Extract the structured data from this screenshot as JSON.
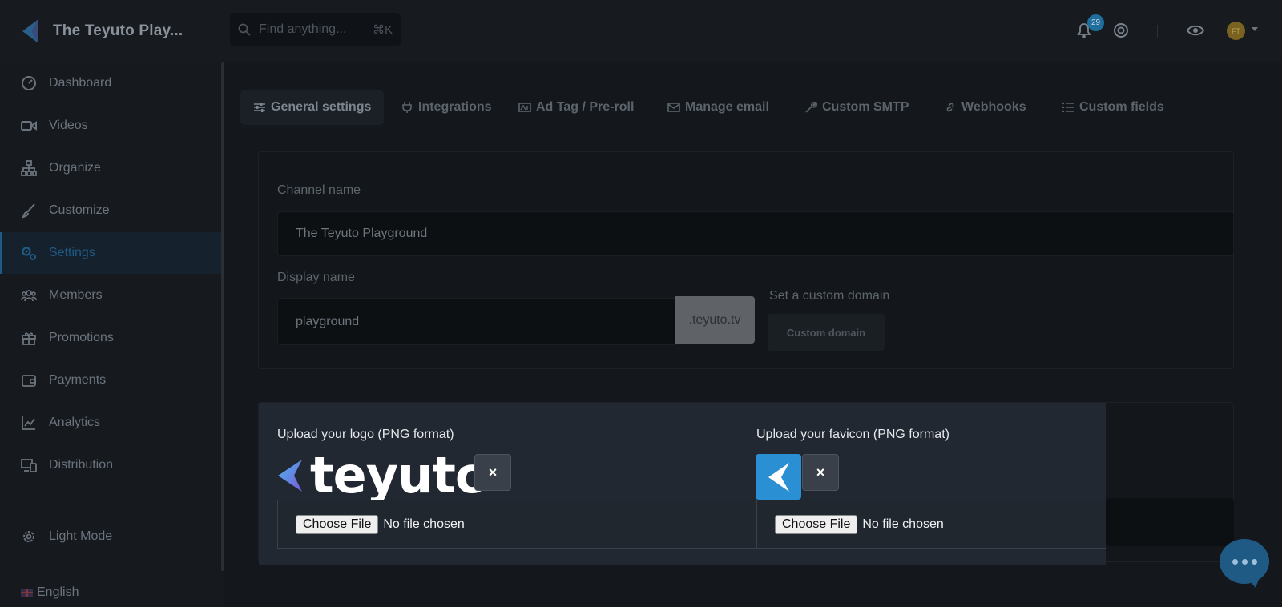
{
  "app": {
    "title": "The Teyuto Play...",
    "search_placeholder": "Find anything...",
    "search_shortcut": "⌘K",
    "notification_count": "29",
    "avatar_initials": "FT"
  },
  "sidebar": {
    "items": [
      {
        "label": "Dashboard",
        "icon": "dashboard-icon"
      },
      {
        "label": "Videos",
        "icon": "video-icon"
      },
      {
        "label": "Organize",
        "icon": "sitemap-icon"
      },
      {
        "label": "Customize",
        "icon": "brush-icon"
      },
      {
        "label": "Settings",
        "icon": "gears-icon",
        "active": true
      },
      {
        "label": "Members",
        "icon": "users-icon"
      },
      {
        "label": "Promotions",
        "icon": "gift-icon"
      },
      {
        "label": "Payments",
        "icon": "wallet-icon"
      },
      {
        "label": "Analytics",
        "icon": "chart-line-icon"
      },
      {
        "label": "Distribution",
        "icon": "devices-icon"
      }
    ],
    "light_mode_label": "Light Mode",
    "language_label": "English"
  },
  "tabs": [
    {
      "label": "General settings",
      "icon": "sliders-icon",
      "active": true
    },
    {
      "label": "Integrations",
      "icon": "plug-icon"
    },
    {
      "label": "Ad Tag / Pre-roll",
      "icon": "ad-icon"
    },
    {
      "label": "Manage email",
      "icon": "envelope-icon"
    },
    {
      "label": "Custom SMTP",
      "icon": "wrench-icon"
    },
    {
      "label": "Webhooks",
      "icon": "link-icon"
    },
    {
      "label": "Custom fields",
      "icon": "list-icon"
    }
  ],
  "general": {
    "channel_name_label": "Channel name",
    "channel_name_value": "The Teyuto Playground",
    "display_name_label": "Display name",
    "display_name_value": "playground",
    "domain_suffix": ".teyuto.tv",
    "custom_domain_label": "Set a custom domain",
    "custom_domain_button": "Custom domain"
  },
  "upload": {
    "logo_label": "Upload your logo (PNG format)",
    "logo_text": "teyuto",
    "favicon_label": "Upload your favicon (PNG format)",
    "remove_symbol": "×",
    "choose_file_label": "Choose File",
    "no_file_label": "No file chosen"
  },
  "colors": {
    "accent": "#1f5a84",
    "favicon_bg": "#2a8fd3",
    "upload_bg": "#212831"
  }
}
